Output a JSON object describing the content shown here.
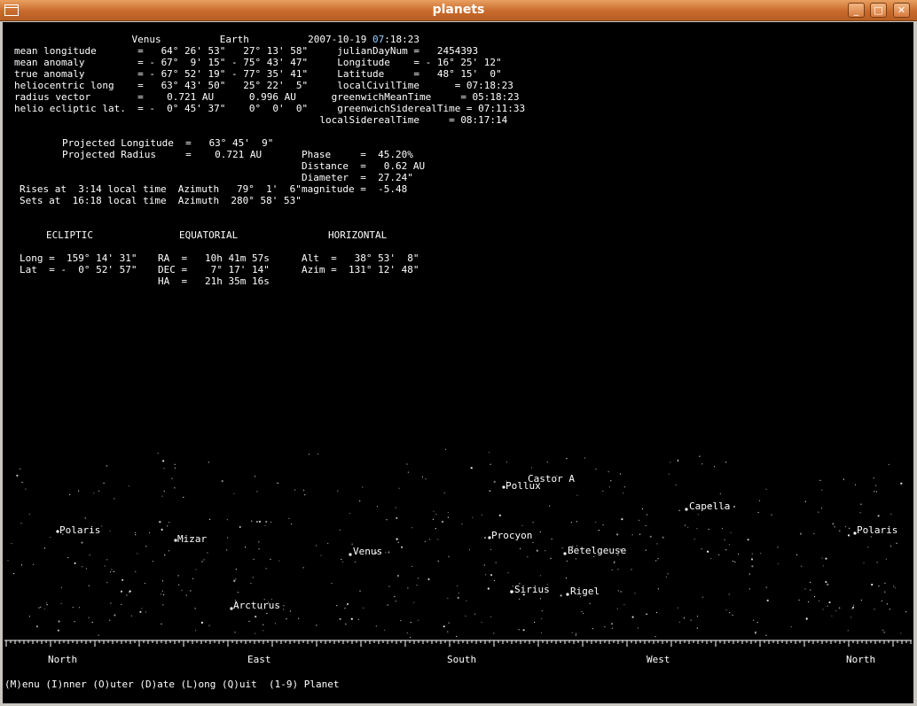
{
  "window": {
    "title": "planets",
    "minimize": "_",
    "maximize": "□",
    "close": "✕"
  },
  "orbital": {
    "header": "                    Venus          Earth          2007-10-19 ",
    "time_hh": "07",
    "time_rest": ":18:23",
    "rows": [
      "mean longitude       =   64° 26' 53\"   27° 13' 58\"     julianDayNum =   2454393",
      "mean anomaly         = - 67°  9' 15\" - 75° 43' 47\"     Longitude    = - 16° 25' 12\"",
      "true anomaly         = - 67° 52' 19\" - 77° 35' 41\"     Latitude     =   48° 15'  0\"",
      "heliocentric long    =   63° 43' 50\"   25° 22'  5\"     localCivilTime      = 07:18:23",
      "radius vector        =    0.721 AU      0.996 AU      greenwichMeanTime     = 05:18:23",
      "helio ecliptic lat.  = -  0° 45' 37\"    0°  0'  0\"     greenwichSiderealTime = 07:11:33",
      "                                                    localSiderealTime     = 08:17:14"
    ]
  },
  "projected": [
    "Projected Longitude  =   63° 45'  9\"",
    "Projected Radius     =    0.721 AU"
  ],
  "physical": [
    "Phase     =  45.20%",
    "Distance  =   0.62 AU",
    "Diameter  =  27.24\"",
    "magnitude =  -5.48"
  ],
  "rise_set": [
    "Rises at  3:14 local time  Azimuth   79°  1'  6\"",
    "Sets at  16:18 local time  Azimuth  280° 58' 53\""
  ],
  "coords": {
    "headers": [
      "ECLIPTIC",
      "EQUATORIAL",
      "HORIZONTAL"
    ],
    "ecliptic": [
      "Long =  159° 14' 31\"",
      "Lat  = -  0° 52' 57\""
    ],
    "equatorial": [
      "RA  =   10h 41m 57s",
      "DEC =    7° 17' 14\"",
      "HA  =   21h 35m 16s"
    ],
    "horizontal": [
      "Alt  =   38° 53'  8\"",
      "Azim =  131° 12' 48\""
    ]
  },
  "sky": {
    "labels": [
      "Polaris",
      "Mizar",
      "Arcturus",
      "Venus",
      "Pollux",
      "Castor A",
      "Procyon",
      "Betelgeuse",
      "Sirius",
      "Rigel",
      "Capella",
      "Polaris"
    ],
    "directions": [
      "North",
      "East",
      "South",
      "West",
      "North"
    ]
  },
  "status_line": "(M)enu (I)nner (O)uter (D)ate (L)ong (Q)uit  (1-9) Planet",
  "colors": {
    "titlebar": "#c86a2c",
    "terminal_bg": "#000000",
    "text": "#ffffff",
    "highlight": "#9ad0ff"
  }
}
